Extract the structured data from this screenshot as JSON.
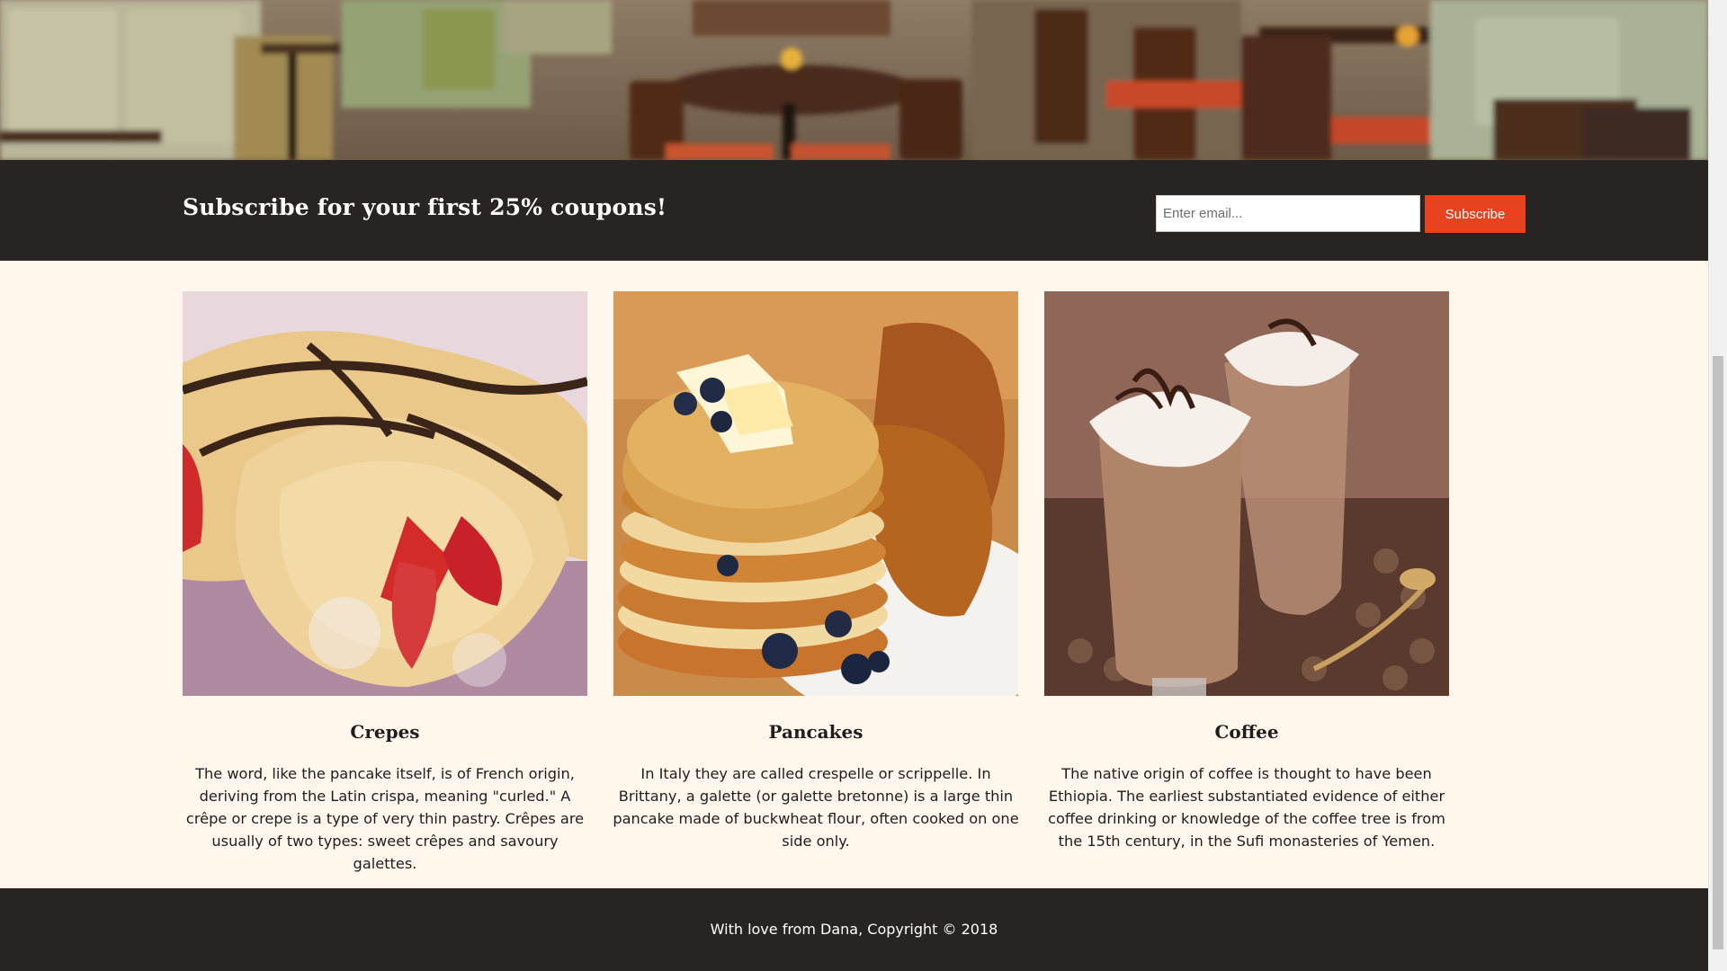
{
  "subscribe": {
    "title": "Subscribe for your first 25% coupons!",
    "email_placeholder": "Enter email...",
    "button_label": "Subscribe"
  },
  "cards": [
    {
      "title": "Crepes",
      "text": "The word, like the pancake itself, is of French origin, deriving from the Latin crispa, meaning \"curled.\" A crêpe or crepe is a type of very thin pastry. Crêpes are usually of two types: sweet crêpes and savoury galettes."
    },
    {
      "title": "Pancakes",
      "text": "In Italy they are called crespelle or scrippelle. In Brittany, a galette (or galette bretonne) is a large thin pancake made of buckwheat flour, often cooked on one side only."
    },
    {
      "title": "Coffee",
      "text": "The native origin of coffee is thought to have been Ethiopia. The earliest substantiated evidence of either coffee drinking or knowledge of the coffee tree is from the 15th century, in the Sufi monasteries of Yemen."
    }
  ],
  "footer": {
    "text": "With love from Dana, Copyright © 2018"
  },
  "colors": {
    "accent": "#e8421f",
    "dark_bar": "#282424",
    "page_bg": "#fff6ec"
  }
}
